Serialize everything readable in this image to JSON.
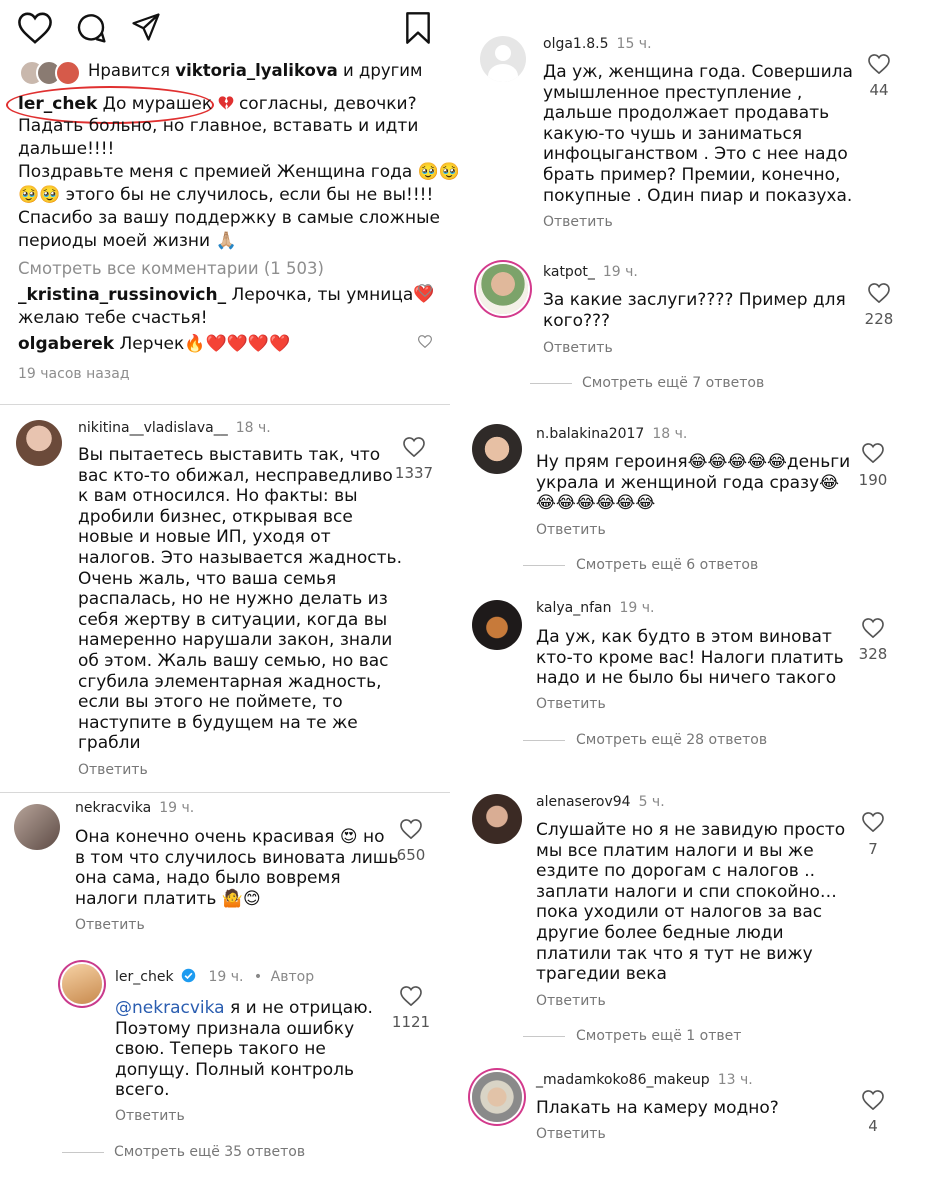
{
  "post": {
    "liked_by_prefix": "Нравится",
    "liked_by_user": "viktoria_lyalikova",
    "liked_by_suffix": "и другим",
    "author": "ler_chek",
    "caption_line1": "До мурашек",
    "caption_line1b": "согласны, девочки?",
    "caption_lines": [
      "Падать больно, но главное, вставать и идти",
      "дальше!!!!",
      "Поздравьте меня с премией Женщина года 🥹🥹",
      "🥹🥹 этого бы не случилось, если бы не вы!!!!",
      "Спасибо за вашу поддержку в самые сложные",
      "периоды моей жизни 🙏🏼"
    ],
    "view_all_comments": "Смотреть все комментарии (1 503)",
    "preview_comments": [
      {
        "user": "_kristina_russinovich_",
        "text_line1": "Лерочка, ты умница❤️",
        "text_line2": "желаю тебе счастья!"
      },
      {
        "user": "olgaberek",
        "text_line1": "Лерчек🔥❤️❤️❤️❤️",
        "text_line2": ""
      }
    ],
    "time_ago": "19 часов назад"
  },
  "reply_label": "Ответить",
  "left_comments": [
    {
      "user": "nikitina__vladislava__",
      "time": "18 ч.",
      "likes": "1337",
      "lines": [
        "Вы пытаетесь выставить так, что",
        "вас кто-то обижал, несправедливо",
        "к вам относился. Но факты: вы",
        "дробили бизнес, открывая все",
        "новые и новые ИП, уходя от",
        "налогов. Это называется жадность.",
        "Очень жаль, что ваша семья",
        "распалась, но не нужно делать из",
        "себя жертву в ситуации, когда вы",
        "намеренно нарушали закон, знали",
        "об этом. Жаль вашу семью, но вас",
        "сгубила элементарная жадность,",
        "если вы этого не поймете, то",
        "наступите в будущем на те же",
        "грабли"
      ]
    },
    {
      "user": "nekracvika",
      "time": "19 ч.",
      "likes": "650",
      "lines": [
        "Она конечно очень красивая 😍 но",
        "в том что случилось виновата лишь",
        "она сама, надо было вовремя",
        "налоги платить 🤷😊"
      ]
    }
  ],
  "author_reply": {
    "user": "ler_chek",
    "time": "19 ч.",
    "author_label": "Автор",
    "likes": "1121",
    "mention": "@nekracvika",
    "line1_rest": "я и не отрицаю.",
    "lines": [
      "Поэтому признала ошибку",
      "свою. Теперь такого не",
      "допущу. Полный контроль",
      "всего."
    ]
  },
  "left_more": "Смотреть ещё 35 ответов",
  "right_comments": [
    {
      "user": "olga1.8.5",
      "time": "15 ч.",
      "likes": "44",
      "lines": [
        "Да уж, женщина года. Совершила",
        "умышленное преступление ,",
        "дальше продолжает продавать",
        "какую-то чушь и заниматься",
        "инфоцыганством . Это с нее надо",
        "брать пример?  Премии, конечно,",
        "покупные . Один пиар и показуха."
      ],
      "more": ""
    },
    {
      "user": "katpot_",
      "time": "19 ч.",
      "likes": "228",
      "lines": [
        "За какие заслуги???? Пример для",
        "кого???"
      ],
      "more": "Смотреть ещё 7 ответов"
    },
    {
      "user": "n.balakina2017",
      "time": "18 ч.",
      "likes": "190",
      "lines": [
        "Ну прям героиня😂😂😂😂😂деньги",
        "украла и женщиной года сразу😂",
        "😂😂😂😂😂😂"
      ],
      "more": "Смотреть ещё 6 ответов"
    },
    {
      "user": "kalya_nfan",
      "time": "19 ч.",
      "likes": "328",
      "lines": [
        "Да уж, как будто в этом виноват",
        "кто-то кроме вас! Налоги платить",
        "надо и не было бы ничего такого"
      ],
      "more": "Смотреть ещё 28 ответов"
    },
    {
      "user": "alenaserov94",
      "time": "5 ч.",
      "likes": "7",
      "lines": [
        "Слушайте но я не завидую просто",
        "мы все платим налоги и вы же",
        "ездите по дорогам с налогов ..",
        "заплати налоги и спи спокойно…",
        "пока уходили от налогов за вас",
        "другие более бедные люди",
        "платили так  что я тут не вижу",
        "трагедии века"
      ],
      "more": "Смотреть ещё 1 ответ"
    },
    {
      "user": "_madamkoko86_makeup",
      "time": "13 ч.",
      "likes": "4",
      "lines": [
        "Плакать на камеру модно?"
      ],
      "more": ""
    }
  ],
  "colors": {
    "accent": "#e03030",
    "verified": "#1d9bf0",
    "mention": "#2a5db0"
  }
}
